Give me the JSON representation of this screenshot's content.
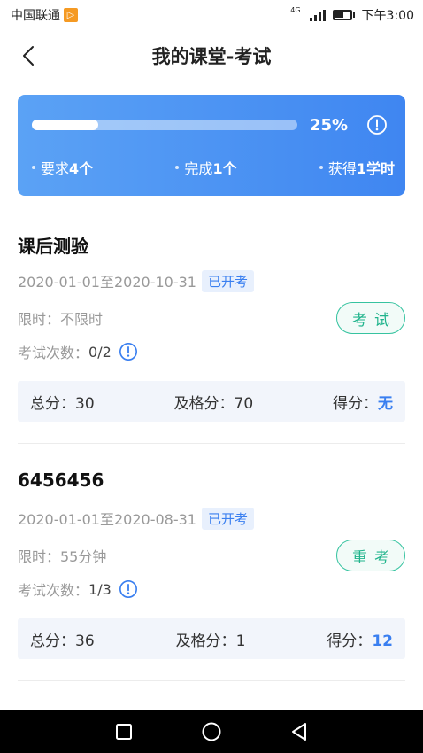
{
  "status_bar": {
    "carrier": "中国联通",
    "network": "4G",
    "time": "下午3:00"
  },
  "nav": {
    "title": "我的课堂-考试"
  },
  "progress": {
    "fraction": 0.25,
    "percent_label": "25%",
    "required_prefix": "要求",
    "required_value": "4个",
    "completed_prefix": "完成",
    "completed_value": "1个",
    "earned_prefix": "获得",
    "earned_value": "1学时"
  },
  "exams": [
    {
      "title": "课后测验",
      "date_range": "2020-01-01至2020-10-31",
      "status": "已开考",
      "limit": "限时：不限时",
      "attempts_label": "考试次数：",
      "attempts_value": "0/2",
      "action": "考试",
      "total_label": "总分：",
      "total": "30",
      "pass_label": "及格分：",
      "pass": "70",
      "score_label": "得分：",
      "score": "无"
    },
    {
      "title": "6456456",
      "date_range": "2020-01-01至2020-08-31",
      "status": "已开考",
      "limit": "限时：55分钟",
      "attempts_label": "考试次数：",
      "attempts_value": "1/3",
      "action": "重考",
      "total_label": "总分：",
      "total": "36",
      "pass_label": "及格分：",
      "pass": "1",
      "score_label": "得分：",
      "score": "12"
    }
  ],
  "colors": {
    "accent_blue": "#3a7ff0",
    "accent_green": "#20b48c",
    "card_gradient_start": "#5ba2f5",
    "card_gradient_end": "#3f86f1"
  }
}
